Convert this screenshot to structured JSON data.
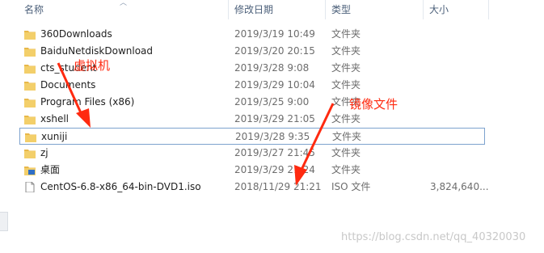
{
  "columns": {
    "name": "名称",
    "modified": "修改日期",
    "type": "类型",
    "size": "大小"
  },
  "files": [
    {
      "name": "360Downloads",
      "modified": "2019/3/19 10:49",
      "type": "文件夹",
      "size": "",
      "icon": "folder-icon"
    },
    {
      "name": "BaiduNetdiskDownload",
      "modified": "2019/3/20 20:15",
      "type": "文件夹",
      "size": "",
      "icon": "folder-icon"
    },
    {
      "name": "cts_student",
      "modified": "2019/3/28 9:08",
      "type": "文件夹",
      "size": "",
      "icon": "folder-icon"
    },
    {
      "name": "Documents",
      "modified": "2019/3/29 10:04",
      "type": "文件夹",
      "size": "",
      "icon": "folder-icon"
    },
    {
      "name": "Program Files (x86)",
      "modified": "2019/3/25 9:00",
      "type": "文件夹",
      "size": "",
      "icon": "folder-icon"
    },
    {
      "name": "xshell",
      "modified": "2019/3/29 21:05",
      "type": "文件夹",
      "size": "",
      "icon": "folder-icon"
    },
    {
      "name": "xuniji",
      "modified": "2019/3/28 9:35",
      "type": "文件夹",
      "size": "",
      "icon": "folder-icon",
      "selected": true
    },
    {
      "name": "zj",
      "modified": "2019/3/27 21:45",
      "type": "文件夹",
      "size": "",
      "icon": "folder-icon"
    },
    {
      "name": "桌面",
      "modified": "2019/3/29 21:24",
      "type": "文件夹",
      "size": "",
      "icon": "desktop-folder-icon"
    },
    {
      "name": "CentOS-6.8-x86_64-bin-DVD1.iso",
      "modified": "2018/11/29 21:21",
      "type": "ISO 文件",
      "size": "3,824,640...",
      "icon": "file-icon"
    }
  ],
  "annotations": {
    "vm_label": "虚拟机",
    "image_label": "镜像文件"
  },
  "watermark": "https://blog.csdn.net/qq_40320030",
  "colors": {
    "annotation": "#ff2a10",
    "folder": "#e8b84a",
    "selection_border": "#7da2ce"
  }
}
